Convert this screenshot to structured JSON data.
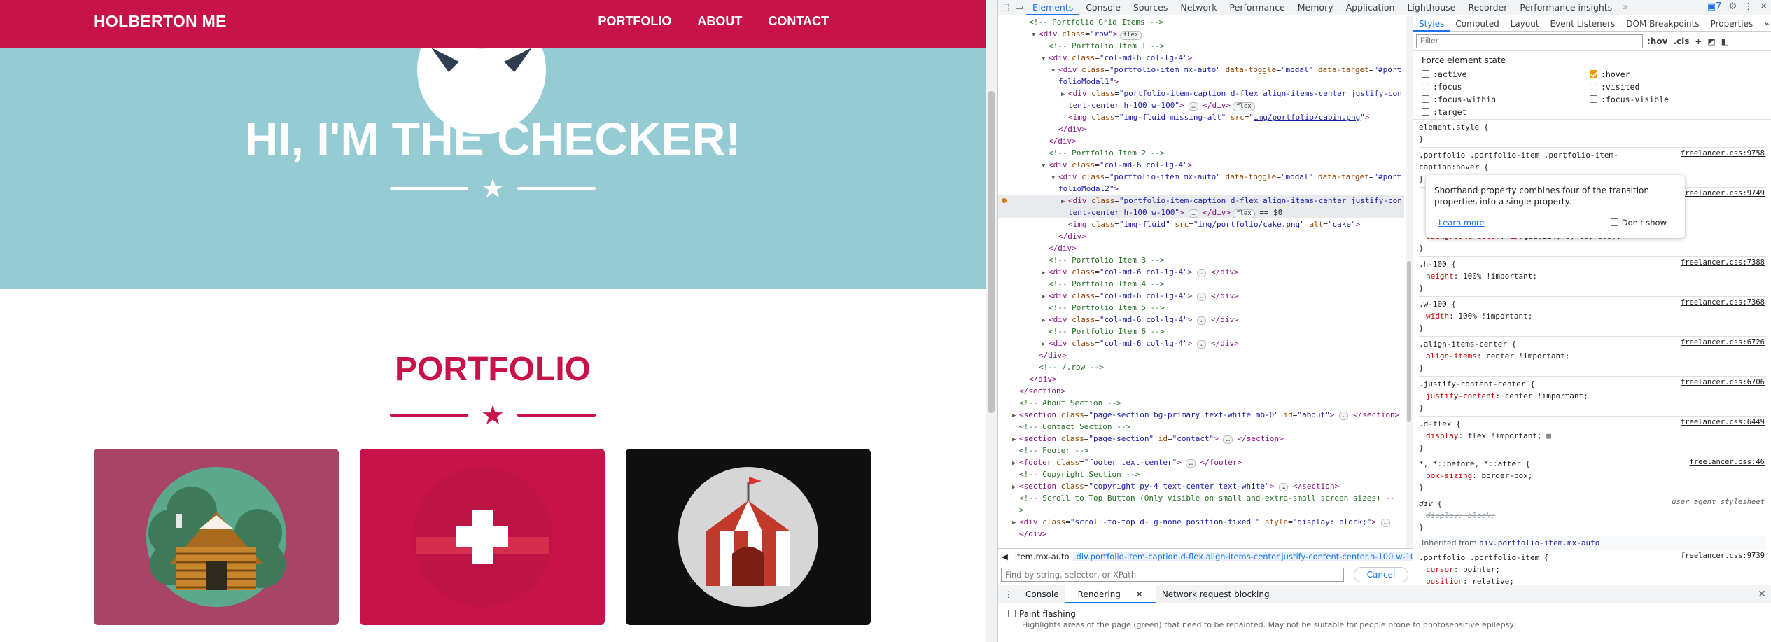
{
  "site": {
    "brand": "HOLBERTON ME",
    "nav": [
      "PORTFOLIO",
      "ABOUT",
      "CONTACT"
    ],
    "hero_title": "HI, I'M THE CHECKER!",
    "portfolio_title": "PORTFOLIO",
    "colors": {
      "primary": "#c8134a",
      "masthead": "#95cbd3",
      "card_cabin": "#a84567",
      "card_cake": "#c8134a",
      "card_circus": "#0f0f0f"
    },
    "icons": [
      "star-icon",
      "cabin-image",
      "cake-image",
      "circus-tent-image"
    ]
  },
  "devtools": {
    "tabs": [
      "Elements",
      "Console",
      "Sources",
      "Network",
      "Performance",
      "Memory",
      "Application",
      "Lighthouse",
      "Recorder",
      "Performance insights"
    ],
    "issues_count": "7",
    "styles_tabs": [
      "Styles",
      "Computed",
      "Layout",
      "Event Listeners",
      "DOM Breakpoints",
      "Properties"
    ],
    "filter_placeholder": "Filter",
    "filter_tools": [
      ":hov",
      ".cls",
      "+"
    ],
    "force_state_title": "Force element state",
    "states_left": [
      ":active",
      ":focus",
      ":focus-within",
      ":target"
    ],
    "states_right": [
      ":hover",
      ":visited",
      ":focus-visible"
    ],
    "tooltip": {
      "text": "Shorthand property combines four of the transition properties into a single property.",
      "learn_more": "Learn more",
      "dont_show": "Don't show"
    },
    "breadcrumbs": [
      "item.mx-auto",
      "div.portfolio-item-caption.d-flex.align-items-center.justify-content-center.h-100.w-100"
    ],
    "search_placeholder": "Find by string, selector, or XPath",
    "cancel": "Cancel",
    "inherited_label": "Inherited from",
    "inherited_from": "div.portfolio-item.mx-auto",
    "drawer_tabs": [
      "Console",
      "Rendering",
      "Network request blocking"
    ],
    "paint_flashing": "Paint flashing",
    "paint_desc": "Highlights areas of the page (green) that need to be repainted. May not be suitable for people prone to photosensitive epilepsy.",
    "dom_lines": [
      {
        "i": 2,
        "h": "<span class='cm'>&lt;!-- Portfolio Grid Items --&gt;</span>"
      },
      {
        "i": 3,
        "a": "▼",
        "h": "<span class='tg'>&lt;div</span> <span class='at'>class</span>=<span class='av'>\"row\"</span><span class='tg'>&gt;</span><span class='badge'>flex</span>"
      },
      {
        "i": 4,
        "h": "<span class='cm'>&lt;!-- Portfolio Item 1 --&gt;</span>"
      },
      {
        "i": 4,
        "a": "▼",
        "h": "<span class='tg'>&lt;div</span> <span class='at'>class</span>=<span class='av'>\"col-md-6 col-lg-4\"</span><span class='tg'>&gt;</span>"
      },
      {
        "i": 5,
        "a": "▼",
        "h": "<span class='tg'>&lt;div</span> <span class='at'>class</span>=<span class='av'>\"portfolio-item mx-auto\"</span> <span class='at'>data-toggle</span>=<span class='av'>\"modal\"</span> <span class='at'>data-target</span>=<span class='av'>\"#port</span>"
      },
      {
        "i": 5,
        "h": "<span class='av'>folioModal1\"</span><span class='tg'>&gt;</span>"
      },
      {
        "i": 6,
        "a": "▶",
        "h": "<span class='tg'>&lt;div</span> <span class='at'>class</span>=<span class='av'>\"portfolio-item-caption d-flex align-items-center justify-con</span>"
      },
      {
        "i": 6,
        "h": "<span class='av'>tent-center h-100 w-100\"</span><span class='tg'>&gt;</span> <span class='ell'>…</span> <span class='tg'>&lt;/div&gt;</span><span class='badge'>flex</span>"
      },
      {
        "i": 6,
        "h": "<span class='tg'>&lt;img</span> <span class='at'>class</span>=<span class='av'>\"img-fluid missing-alt\"</span> <span class='at'>src</span>=<span class='av'>\"<span class='lk'>img/portfolio/cabin.png</span>\"</span><span class='tg'>&gt;</span>"
      },
      {
        "i": 5,
        "h": "<span class='tg'>&lt;/div&gt;</span>"
      },
      {
        "i": 4,
        "h": "<span class='tg'>&lt;/div&gt;</span>"
      },
      {
        "i": 4,
        "h": "<span class='cm'>&lt;!-- Portfolio Item 2 --&gt;</span>"
      },
      {
        "i": 4,
        "a": "▼",
        "h": "<span class='tg'>&lt;div</span> <span class='at'>class</span>=<span class='av'>\"col-md-6 col-lg-4\"</span><span class='tg'>&gt;</span>"
      },
      {
        "i": 5,
        "a": "▼",
        "h": "<span class='tg'>&lt;div</span> <span class='at'>class</span>=<span class='av'>\"portfolio-item mx-auto\"</span> <span class='at'>data-toggle</span>=<span class='av'>\"modal\"</span> <span class='at'>data-target</span>=<span class='av'>\"#port</span>"
      },
      {
        "i": 5,
        "h": "<span class='av'>folioModal2\"</span><span class='tg'>&gt;</span>"
      },
      {
        "i": 6,
        "a": "▶",
        "s": 1,
        "h": "<span class='tg'>&lt;div</span> <span class='at'>class</span>=<span class='av'>\"portfolio-item-caption d-flex align-items-center justify-con</span>"
      },
      {
        "i": 6,
        "s": 1,
        "h": "<span class='av'>tent-center h-100 w-100\"</span><span class='tg'>&gt;</span> <span class='ell'>…</span> <span class='tg'>&lt;/div&gt;</span><span class='badge'>flex</span> <span class='pl'>== $0</span>"
      },
      {
        "i": 6,
        "h": "<span class='tg'>&lt;img</span> <span class='at'>class</span>=<span class='av'>\"img-fluid\"</span> <span class='at'>src</span>=<span class='av'>\"<span class='lk'>img/portfolio/cake.png</span>\"</span> <span class='at'>alt</span>=<span class='av'>\"cake\"</span><span class='tg'>&gt;</span>"
      },
      {
        "i": 5,
        "h": "<span class='tg'>&lt;/div&gt;</span>"
      },
      {
        "i": 4,
        "h": "<span class='tg'>&lt;/div&gt;</span>"
      },
      {
        "i": 4,
        "h": "<span class='cm'>&lt;!-- Portfolio Item 3 --&gt;</span>"
      },
      {
        "i": 4,
        "a": "▶",
        "h": "<span class='tg'>&lt;div</span> <span class='at'>class</span>=<span class='av'>\"col-md-6 col-lg-4\"</span><span class='tg'>&gt;</span> <span class='ell'>…</span> <span class='tg'>&lt;/div&gt;</span>"
      },
      {
        "i": 4,
        "h": "<span class='cm'>&lt;!-- Portfolio Item 4 --&gt;</span>"
      },
      {
        "i": 4,
        "a": "▶",
        "h": "<span class='tg'>&lt;div</span> <span class='at'>class</span>=<span class='av'>\"col-md-6 col-lg-4\"</span><span class='tg'>&gt;</span> <span class='ell'>…</span> <span class='tg'>&lt;/div&gt;</span>"
      },
      {
        "i": 4,
        "h": "<span class='cm'>&lt;!-- Portfolio Item 5 --&gt;</span>"
      },
      {
        "i": 4,
        "a": "▶",
        "h": "<span class='tg'>&lt;div</span> <span class='at'>class</span>=<span class='av'>\"col-md-6 col-lg-4\"</span><span class='tg'>&gt;</span> <span class='ell'>…</span> <span class='tg'>&lt;/div&gt;</span>"
      },
      {
        "i": 4,
        "h": "<span class='cm'>&lt;!-- Portfolio Item 6 --&gt;</span>"
      },
      {
        "i": 4,
        "a": "▶",
        "h": "<span class='tg'>&lt;div</span> <span class='at'>class</span>=<span class='av'>\"col-md-6 col-lg-4\"</span><span class='tg'>&gt;</span> <span class='ell'>…</span> <span class='tg'>&lt;/div&gt;</span>"
      },
      {
        "i": 3,
        "h": "<span class='tg'>&lt;/div&gt;</span>"
      },
      {
        "i": 3,
        "h": "<span class='cm'>&lt;!-- /.row --&gt;</span>"
      },
      {
        "i": 2,
        "h": "<span class='tg'>&lt;/div&gt;</span>"
      },
      {
        "i": 1,
        "h": "<span class='tg'>&lt;/section&gt;</span>"
      },
      {
        "i": 1,
        "h": "<span class='cm'>&lt;!-- About Section --&gt;</span>"
      },
      {
        "i": 1,
        "a": "▶",
        "h": "<span class='tg'>&lt;section</span> <span class='at'>class</span>=<span class='av'>\"page-section bg-primary text-white mb-0\"</span> <span class='at'>id</span>=<span class='av'>\"about\"</span><span class='tg'>&gt;</span> <span class='ell'>…</span> <span class='tg'>&lt;/section&gt;</span>"
      },
      {
        "i": 1,
        "h": "<span class='cm'>&lt;!-- Contact Section --&gt;</span>"
      },
      {
        "i": 1,
        "a": "▶",
        "h": "<span class='tg'>&lt;section</span> <span class='at'>class</span>=<span class='av'>\"page-section\"</span> <span class='at'>id</span>=<span class='av'>\"contact\"</span><span class='tg'>&gt;</span> <span class='ell'>…</span> <span class='tg'>&lt;/section&gt;</span>"
      },
      {
        "i": 1,
        "h": "<span class='cm'>&lt;!-- Footer --&gt;</span>"
      },
      {
        "i": 1,
        "a": "▶",
        "h": "<span class='tg'>&lt;footer</span> <span class='at'>class</span>=<span class='av'>\"footer text-center\"</span><span class='tg'>&gt;</span> <span class='ell'>…</span> <span class='tg'>&lt;/footer&gt;</span>"
      },
      {
        "i": 1,
        "h": "<span class='cm'>&lt;!-- Copyright Section --&gt;</span>"
      },
      {
        "i": 1,
        "a": "▶",
        "h": "<span class='tg'>&lt;section</span> <span class='at'>class</span>=<span class='av'>\"copyright py-4 text-center text-white\"</span><span class='tg'>&gt;</span> <span class='ell'>…</span> <span class='tg'>&lt;/section&gt;</span>"
      },
      {
        "i": 1,
        "h": "<span class='cm'>&lt;!-- Scroll to Top Button (Only visible on small and extra-small screen sizes) --</span>"
      },
      {
        "i": 1,
        "h": "<span class='cm'>&gt;</span>"
      },
      {
        "i": 1,
        "a": "▶",
        "h": "<span class='tg'>&lt;div</span> <span class='at'>class</span>=<span class='av'>\"scroll-to-top d-lg-none position-fixed \"</span> <span class='at'>style</span>=<span class='av'>\"display: block;\"</span><span class='tg'>&gt;</span> <span class='ell'>…</span>"
      },
      {
        "i": 1,
        "h": "<span class='tg'>&lt;/div&gt;</span>"
      }
    ],
    "rules": [
      {
        "sel": "element.style {",
        "src": "",
        "lines": [],
        "close": "}"
      },
      {
        "sel": ".portfolio .portfolio-item .portfolio-item-",
        "sel2": "caption:hover {",
        "src": "freelancer.css:9758",
        "lines": [],
        "close": "}"
      },
      {
        "sel": "",
        "src": "freelancer.css:9749",
        "lines": [
          "<span class='strike'>left: 0;</span>",
          "<span class='pn'>transition</span>: ▶ <span class='pv'>all 0.2s</span> <span class='cb on' style='width:9px;height:9px;background:#b05ae0;border-color:#b05ae0'></span><span class='pv'>ease-in-out</span>;",
          "<span class='strike'>opacity: 0;</span>",
          "<span class='pn'>background-color</span>: <span class='sw' style='background:rgba(224,0,60,0.9)'></span><span class='pv'>rgba(224, 0, 60, 0.9)</span>;"
        ],
        "close": "}"
      },
      {
        "sel": ".h-100 {",
        "src": "freelancer.css:7388",
        "lines": [
          "<span class='pn'>height</span>: <span class='pv'>100% !important</span>;"
        ],
        "close": "}"
      },
      {
        "sel": ".w-100 {",
        "src": "freelancer.css:7368",
        "lines": [
          "<span class='pn'>width</span>: <span class='pv'>100% !important</span>;"
        ],
        "close": "}"
      },
      {
        "sel": ".align-items-center {",
        "src": "freelancer.css:6726",
        "lines": [
          "<span class='pn'>align-items</span>: <span class='pv'>center !important</span>;"
        ],
        "close": "}"
      },
      {
        "sel": ".justify-content-center {",
        "src": "freelancer.css:6706",
        "lines": [
          "<span class='pn'>justify-content</span>: <span class='pv'>center !important</span>;"
        ],
        "close": "}"
      },
      {
        "sel": ".d-flex {",
        "src": "freelancer.css:6449",
        "lines": [
          "<span class='pn'>display</span>: <span class='pv'>flex !important</span>; <span style='color:#5f6368'>▦</span>"
        ],
        "close": "}"
      },
      {
        "sel": "*, *::before, *::after {",
        "src": "freelancer.css:46",
        "lines": [
          "<span class='pn'>box-sizing</span>: <span class='pv'>border-box</span>;"
        ],
        "close": "}"
      },
      {
        "sel": "<i>div</i> {",
        "src": "user agent stylesheet",
        "ua": 1,
        "lines": [
          "<span class='strike'><i>display: block;</i></span>"
        ],
        "close": "}"
      }
    ],
    "inherited_rule": {
      "sel": ".portfolio .portfolio-item {",
      "src": "freelancer.css:9739",
      "lines": [
        "<span class='pn'>cursor</span>: <span class='pv'>pointer</span>;",
        "<span class='pn'>position</span>: <span class='pv'>relative</span>;"
      ]
    }
  }
}
